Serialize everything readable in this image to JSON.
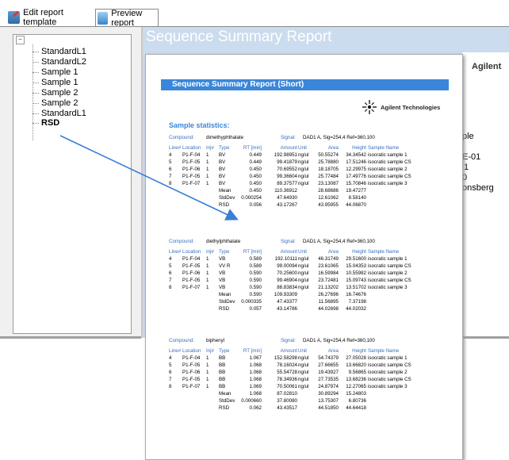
{
  "tabs": [
    {
      "label": "Edit report template",
      "icon": "edit-template-icon"
    },
    {
      "label": "Preview report",
      "icon": "preview-icon"
    }
  ],
  "tree": {
    "items": [
      "StandardL1",
      "StandardL2",
      "Sample 1",
      "Sample 1",
      "Sample 2",
      "Sample 2",
      "StandardL1",
      "RSD"
    ],
    "selected_index": 7
  },
  "panel_title": "Sequence Summary Report",
  "back_page": {
    "agilent": "Agilent",
    "lines": [
      "ple",
      "E-01",
      "1",
      "0",
      "onsberg"
    ]
  },
  "report": {
    "banner": "Sequence Summary Report (Short)",
    "logo_text": "Agilent Technologies",
    "sample_stats_label": "Sample statistics:",
    "compound_label": "Compound:",
    "signal_label": "Signal:",
    "columns": [
      "Line#",
      "Location",
      "Inj#",
      "Type",
      "RT [min]",
      "Amount",
      "Unit",
      "Area",
      "Height",
      "Sample Name"
    ],
    "sections": [
      {
        "compound": "dimethyphthalate",
        "signal": "DAD1 A, Sig=254,4 Ref=360,100",
        "rows": [
          [
            "4",
            "P1-F-04",
            "1",
            "BV",
            "0.449",
            "192.98951",
            "ng/ul",
            "50.55274",
            "34.34542",
            "isocratic sample 1"
          ],
          [
            "5",
            "P1-F-05",
            "1",
            "BV",
            "0.449",
            "99.41879",
            "ng/ul",
            "25.78880",
            "17.51246",
            "isocratic sample CS"
          ],
          [
            "6",
            "P1-F-06",
            "1",
            "BV",
            "0.450",
            "70.69552",
            "ng/ul",
            "18.18705",
            "12.29975",
            "isocratic sample 2"
          ],
          [
            "7",
            "P1-F-05",
            "1",
            "BV",
            "0.450",
            "99.36604",
            "ng/ul",
            "25.77484",
            "17.49776",
            "isocratic sample CS"
          ],
          [
            "8",
            "P1-F-07",
            "1",
            "BV",
            "0.450",
            "89.37577",
            "ng/ul",
            "23.13087",
            "15.70846",
            "isocratic sample 3"
          ]
        ],
        "stats": [
          [
            "Mean",
            "0.450",
            "110.36912",
            "28.68686",
            "19.47277"
          ],
          [
            "StdDev",
            "0.000254",
            "47.64930",
            "12.61062",
            "8.58140"
          ],
          [
            "RSD",
            "0.056",
            "43.17267",
            "43.95955",
            "44.06870"
          ]
        ]
      },
      {
        "compound": "diethylphthalate",
        "signal": "DAD1 A, Sig=254,4 Ref=360,100",
        "rows": [
          [
            "4",
            "P1-F-04",
            "1",
            "VB",
            "0.589",
            "192.10111",
            "ng/ul",
            "46.31749",
            "29.51600",
            "isocratic sample 1"
          ],
          [
            "5",
            "P1-F-05",
            "1",
            "VV R",
            "0.589",
            "99.00094",
            "ng/ul",
            "23.61065",
            "15.04353",
            "isocratic sample CS"
          ],
          [
            "6",
            "P1-F-06",
            "1",
            "VB",
            "0.590",
            "70.25600",
            "ng/ul",
            "16.59984",
            "10.55982",
            "isocratic sample 2"
          ],
          [
            "7",
            "P1-F-05",
            "1",
            "VB",
            "0.590",
            "99.46904",
            "ng/ul",
            "23.72481",
            "15.09743",
            "isocratic sample CS"
          ],
          [
            "8",
            "P1-F-07",
            "1",
            "VB",
            "0.590",
            "88.83834",
            "ng/ul",
            "21.13202",
            "13.51702",
            "isocratic sample 3"
          ]
        ],
        "stats": [
          [
            "Mean",
            "0.590",
            "109.93309",
            "26.27696",
            "16.74676"
          ],
          [
            "StdDev",
            "0.000335",
            "47.43377",
            "11.56895",
            "7.37198"
          ],
          [
            "RSD",
            "0.057",
            "43.14786",
            "44.02698",
            "44.02032"
          ]
        ]
      },
      {
        "compound": "biphenyl",
        "signal": "DAD1 A, Sig=254,4 Ref=360,100",
        "rows": [
          [
            "4",
            "P1-F-04",
            "1",
            "BB",
            "1.067",
            "152.58298",
            "ng/ul",
            "54.74379",
            "27.05028",
            "isocratic sample 1"
          ],
          [
            "5",
            "P1-F-05",
            "1",
            "BB",
            "1.068",
            "78.16024",
            "ng/ul",
            "27.66655",
            "13.66820",
            "isocratic sample CS"
          ],
          [
            "6",
            "P1-F-06",
            "1",
            "BB",
            "1.068",
            "55.54728",
            "ng/ul",
            "19.43927",
            "9.56865",
            "isocratic sample 2"
          ],
          [
            "7",
            "P1-F-05",
            "1",
            "BB",
            "1.068",
            "78.34936",
            "ng/ul",
            "27.73535",
            "13.68236",
            "isocratic sample CS"
          ],
          [
            "8",
            "P1-F-07",
            "1",
            "BB",
            "1.069",
            "70.50061",
            "ng/ul",
            "24.87974",
            "12.27065",
            "isocratic sample 3"
          ]
        ],
        "stats": [
          [
            "Mean",
            "1.068",
            "87.02810",
            "30.89294",
            "15.24803"
          ],
          [
            "StdDev",
            "0.000660",
            "37.80080",
            "13.75307",
            "6.80736"
          ],
          [
            "RSD",
            "0.062",
            "43.43517",
            "44.51850",
            "44.64418"
          ]
        ]
      }
    ]
  },
  "colors": {
    "panel_bg": "#ccdcef",
    "banner_blue": "#3a87d9",
    "arrow_blue": "#3a7fd5"
  }
}
